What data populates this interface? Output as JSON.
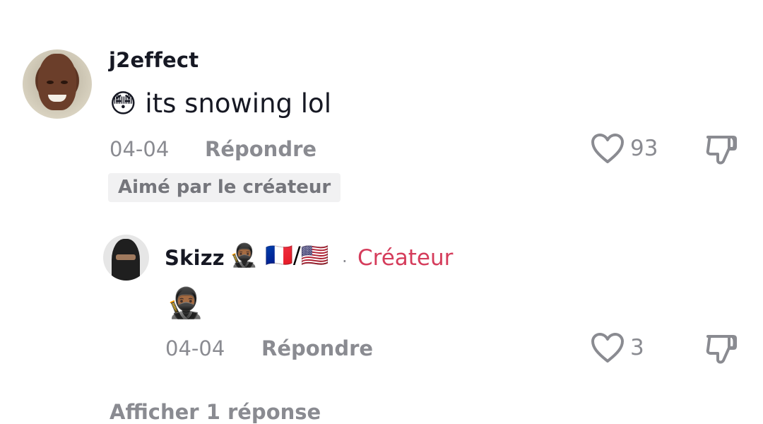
{
  "comment": {
    "username": "j2effect",
    "emoji": "😳",
    "text": "its snowing lol",
    "date": "04-04",
    "reply_label": "Répondre",
    "like_count": "93",
    "badge": "Aimé par le créateur"
  },
  "reply": {
    "username": "Skizz",
    "name_emojis": "🥷🏾 🇫🇷/🇺🇸",
    "separator": "·",
    "creator_label": "Créateur",
    "text_emoji": "🥷🏾",
    "date": "04-04",
    "reply_label": "Répondre",
    "like_count": "3"
  },
  "footer": {
    "partial_text": "Afficher 1 réponse"
  },
  "colors": {
    "creator": "#d53c5b",
    "meta_gray": "#8a8b91",
    "text": "#161823"
  }
}
